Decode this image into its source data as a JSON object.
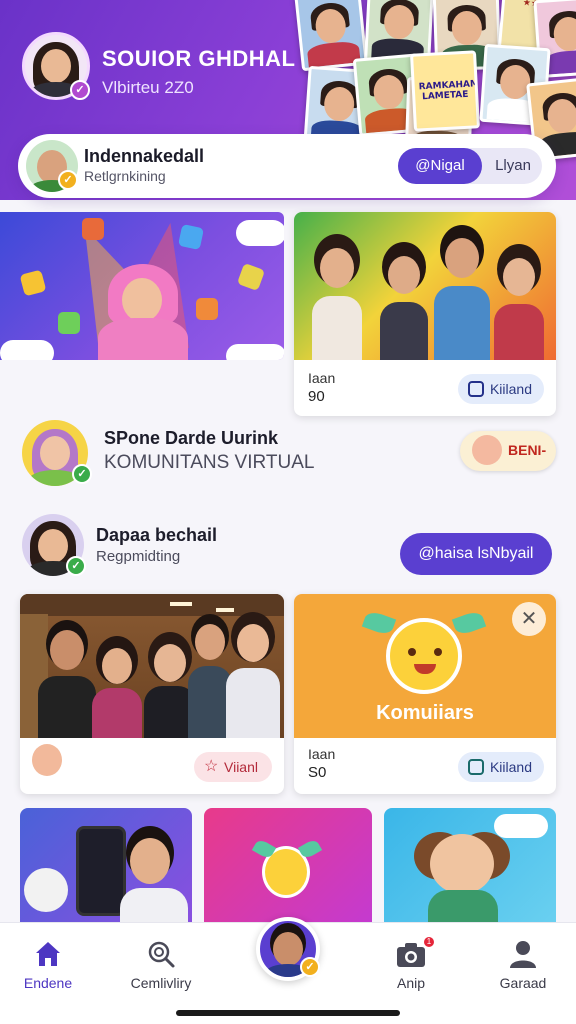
{
  "header": {
    "title": "SOUIOR GHDHAL",
    "subtitle": "Vlbirteu 2Z0",
    "poster_text": "RAMKAHAM LAMETAE"
  },
  "user_card": {
    "name": "Indennakedall",
    "subtitle": "Retlgrnkining",
    "segment_active": "@Nigal",
    "segment_inactive": "Llyan"
  },
  "feature_cards": [
    {
      "label": "Iaan",
      "value": "90",
      "button": "Kiiland"
    }
  ],
  "communities": [
    {
      "title": "SPone Darde Uurink",
      "subtitle": "KOMUNITANS VIRTUAL",
      "badge": "BENI-"
    },
    {
      "title": "Dapaa bechail",
      "subtitle": "Regpmidting",
      "button": "@haisa lsNbyail"
    }
  ],
  "cards_row2": [
    {
      "emoji": "face-emoji",
      "button": "Viianl"
    },
    {
      "title": "Komuiiars",
      "label": "Iaan",
      "value": "S0",
      "button": "Kiiland"
    }
  ],
  "nav": [
    {
      "label": "Endene",
      "icon": "home-icon",
      "active": true
    },
    {
      "label": "Cemlivliry",
      "icon": "search-icon",
      "active": false
    },
    {
      "label": "",
      "icon": "profile-avatar",
      "active": false
    },
    {
      "label": "Anip",
      "icon": "camera-icon",
      "active": false,
      "badge": "1"
    },
    {
      "label": "Garaad",
      "icon": "person-icon",
      "active": false
    }
  ],
  "colors": {
    "primary": "#5a3fd0",
    "header_start": "#6a32c8",
    "header_end": "#b14fd8",
    "accent_orange": "#f4a73a"
  }
}
